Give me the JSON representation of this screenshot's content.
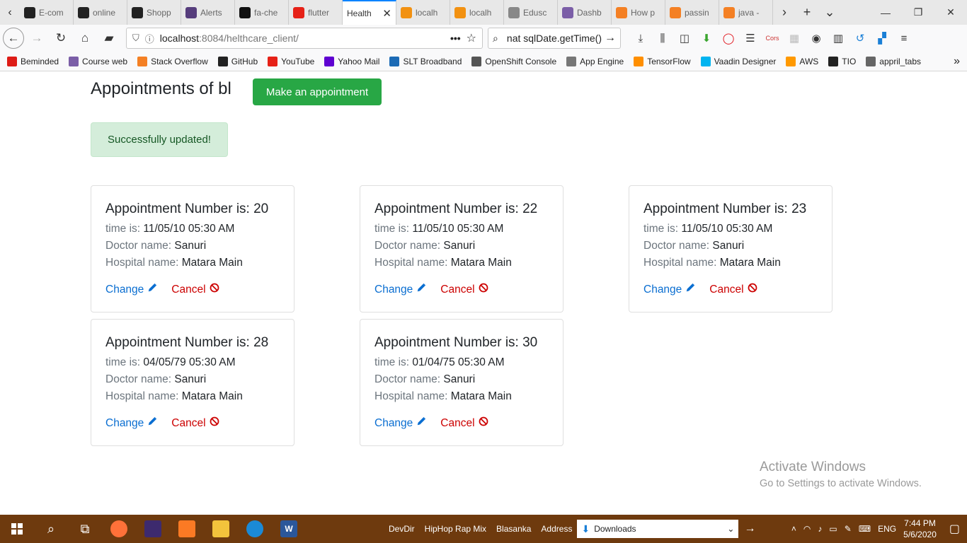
{
  "browser": {
    "tabs": [
      {
        "label": "E-com",
        "icon": "github-icon",
        "color": "#222222",
        "active": false
      },
      {
        "label": "online",
        "icon": "github-icon",
        "color": "#222222",
        "active": false
      },
      {
        "label": "Shopp",
        "icon": "github-icon",
        "color": "#222222",
        "active": false
      },
      {
        "label": "Alerts",
        "icon": "bootstrap-icon",
        "color": "#563d7c",
        "active": false
      },
      {
        "label": "fa-che",
        "icon": "codepen-icon",
        "color": "#111111",
        "active": false
      },
      {
        "label": "flutter",
        "icon": "youtube-icon",
        "color": "#e62117",
        "active": false
      },
      {
        "label": "Health",
        "icon": "",
        "color": "#ffffff",
        "active": true
      },
      {
        "label": "localh",
        "icon": "phpmyadmin-icon",
        "color": "#f29111",
        "active": false
      },
      {
        "label": "localh",
        "icon": "phpmyadmin-icon",
        "color": "#f29111",
        "active": false
      },
      {
        "label": "Edusc",
        "icon": "play-icon",
        "color": "#888888",
        "active": false
      },
      {
        "label": "Dashb",
        "icon": "course-web-icon",
        "color": "#7b5ea7",
        "active": false
      },
      {
        "label": "How p",
        "icon": "stackoverflow-icon",
        "color": "#f48024",
        "active": false
      },
      {
        "label": "passin",
        "icon": "stackoverflow-icon",
        "color": "#f48024",
        "active": false
      },
      {
        "label": "java -",
        "icon": "stackoverflow-icon",
        "color": "#f48024",
        "active": false
      }
    ],
    "url_host": "localhost",
    "url_rest": ":8084/helthcare_client/",
    "search_query": "nat sqlDate.getTime()",
    "bookmarks": [
      {
        "label": "Beminded",
        "icon": "angular-icon",
        "color": "#dd1b16"
      },
      {
        "label": "Course web",
        "icon": "course-web-icon",
        "color": "#7b5ea7"
      },
      {
        "label": "Stack Overflow",
        "icon": "stackoverflow-icon",
        "color": "#f48024"
      },
      {
        "label": "GitHub",
        "icon": "github-icon",
        "color": "#222222"
      },
      {
        "label": "YouTube",
        "icon": "youtube-icon",
        "color": "#e62117"
      },
      {
        "label": "Yahoo Mail",
        "icon": "yahoo-mail-icon",
        "color": "#5f01d1"
      },
      {
        "label": "SLT Broadband",
        "icon": "slt-icon",
        "color": "#1b6ab5"
      },
      {
        "label": "OpenShift Console",
        "icon": "globe-icon",
        "color": "#555555"
      },
      {
        "label": "App Engine",
        "icon": "gear-icon",
        "color": "#777777"
      },
      {
        "label": "TensorFlow",
        "icon": "tensorflow-icon",
        "color": "#ff8f00"
      },
      {
        "label": "Vaadin Designer",
        "icon": "vaadin-icon",
        "color": "#00b4f0"
      },
      {
        "label": "AWS",
        "icon": "aws-icon",
        "color": "#ff9900"
      },
      {
        "label": "TIO",
        "icon": "tio-icon",
        "color": "#222222"
      },
      {
        "label": "appril_tabs",
        "icon": "folder-icon",
        "color": "#666666"
      }
    ]
  },
  "page": {
    "title": "Appointments of bl",
    "make_button": "Make an appointment",
    "alert": "Successfully updated!",
    "labels": {
      "appointment_prefix": "Appointment Number is: ",
      "time": "time is: ",
      "doctor": "Doctor name: ",
      "hospital": "Hospital name: ",
      "change": "Change",
      "cancel": "Cancel"
    },
    "appointments": [
      {
        "number": "20",
        "time": "11/05/10 05:30 AM",
        "doctor": "Sanuri",
        "hospital": "Matara Main"
      },
      {
        "number": "22",
        "time": "11/05/10 05:30 AM",
        "doctor": "Sanuri",
        "hospital": "Matara Main"
      },
      {
        "number": "23",
        "time": "11/05/10 05:30 AM",
        "doctor": "Sanuri",
        "hospital": "Matara Main"
      },
      {
        "number": "28",
        "time": "04/05/79 05:30 AM",
        "doctor": "Sanuri",
        "hospital": "Matara Main"
      },
      {
        "number": "30",
        "time": "01/04/75 05:30 AM",
        "doctor": "Sanuri",
        "hospital": "Matara Main"
      }
    ],
    "colors": {
      "success": "#28a745",
      "alert_bg": "#d4edda",
      "link": "#0a6ed1",
      "danger": "#cc0000"
    }
  },
  "watermark": {
    "line1": "Activate Windows",
    "line2": "Go to Settings to activate Windows."
  },
  "taskbar": {
    "toolbars": [
      "DevDir",
      "HipHop Rap Mix",
      "Blasanka",
      "Address"
    ],
    "address_value": "Downloads",
    "language": "ENG",
    "time": "7:44 PM",
    "date": "5/6/2020"
  }
}
